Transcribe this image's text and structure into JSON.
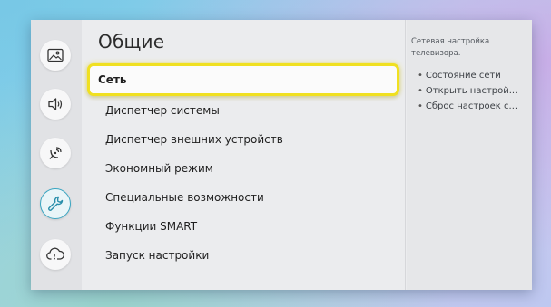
{
  "header": {
    "title": "Общие"
  },
  "sidebar": {
    "items": [
      {
        "icon": "picture-icon",
        "active": false
      },
      {
        "icon": "sound-icon",
        "active": false
      },
      {
        "icon": "broadcast-icon",
        "active": false
      },
      {
        "icon": "wrench-icon",
        "active": true
      },
      {
        "icon": "support-icon",
        "active": false
      }
    ]
  },
  "menu": {
    "items": [
      {
        "label": "Сеть",
        "focused": true
      },
      {
        "label": "Диспетчер системы",
        "focused": false
      },
      {
        "label": "Диспетчер внешних устройств",
        "focused": false
      },
      {
        "label": "Экономный режим",
        "focused": false
      },
      {
        "label": "Специальные возможности",
        "focused": false
      },
      {
        "label": "Функции SMART",
        "focused": false
      },
      {
        "label": "Запуск настройки",
        "focused": false
      }
    ]
  },
  "info_panel": {
    "description": "Сетевая настройка телевизора.",
    "bullets": [
      "Состояние сети",
      "Открыть настрой...",
      "Сброс настроек с..."
    ]
  },
  "colors": {
    "focus_border": "#f0e020",
    "active_icon_accent": "#3aa6c2"
  }
}
